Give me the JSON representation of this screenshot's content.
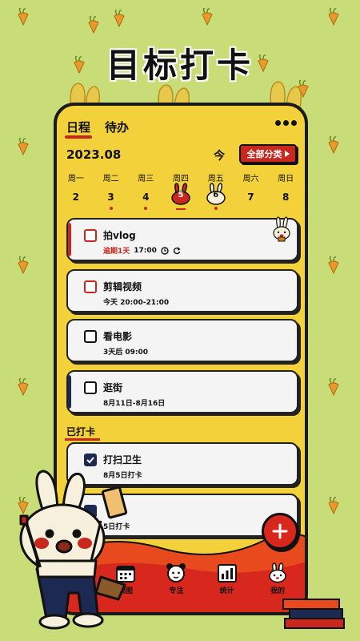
{
  "poster": {
    "title": "目标打卡"
  },
  "tabs": [
    {
      "label": "日程",
      "active": true
    },
    {
      "label": "待办",
      "active": false
    }
  ],
  "header": {
    "month": "2023.08",
    "today_label": "今",
    "filter_label": "全部分类"
  },
  "week": [
    {
      "weekday": "周一",
      "date": "2",
      "dot": false
    },
    {
      "weekday": "周二",
      "date": "3",
      "dot": true
    },
    {
      "weekday": "周三",
      "date": "4",
      "dot": true
    },
    {
      "weekday": "周四",
      "date": "5",
      "dot": false,
      "selected": true
    },
    {
      "weekday": "周五",
      "date": "6",
      "dot": true
    },
    {
      "weekday": "周六",
      "date": "7",
      "dot": false
    },
    {
      "weekday": "周日",
      "date": "8",
      "dot": false
    }
  ],
  "tasks": [
    {
      "title": "拍vlog",
      "overdue": "逾期1天",
      "time": "17:00",
      "checkbox_color": "red"
    },
    {
      "title": "剪辑视频",
      "time": "今天 20:00-21:00",
      "checkbox_color": "red"
    },
    {
      "title": "看电影",
      "time": "3天后 09:00",
      "checkbox_color": "black"
    },
    {
      "title": "逛街",
      "time": "8月11日-8月16日",
      "checkbox_color": "black"
    }
  ],
  "done_section": {
    "label": "已打卡",
    "items": [
      {
        "title": "打扫卫生",
        "time": "8月5日打卡",
        "checked": true
      },
      {
        "title": "",
        "time": "5日打卡",
        "checked": true
      }
    ]
  },
  "bottom_nav": [
    {
      "label": "视图",
      "icon": "calendar-icon"
    },
    {
      "label": "专注",
      "icon": "alarm-clock-icon"
    },
    {
      "label": "统计",
      "icon": "chart-icon"
    },
    {
      "label": "我的",
      "icon": "bunny-face-icon"
    }
  ],
  "colors": {
    "background": "#c8dc78",
    "phone": "#f3d13a",
    "accent_red": "#c8281e",
    "card": "#f4f4f4",
    "navy": "#1c2a52"
  }
}
